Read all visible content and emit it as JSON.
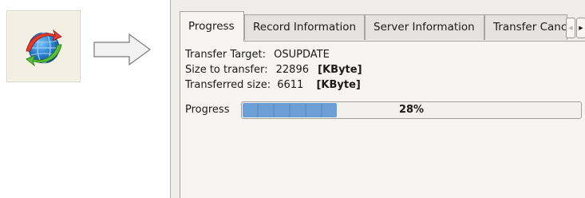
{
  "colors": {
    "progress_fill": "#6c9fd6",
    "panel_background": "#f6f5f2"
  },
  "launcher": {
    "icon": "globe-transfer-icon"
  },
  "arrow_icon": "right-arrow-icon",
  "tabs": [
    {
      "label": "Progress",
      "active": true
    },
    {
      "label": "Record Information",
      "active": false
    },
    {
      "label": "Server Information",
      "active": false
    },
    {
      "label": "Transfer Cancel",
      "active": false
    }
  ],
  "tab_scroll": {
    "prev_icon": "chevron-left-icon",
    "next_icon": "chevron-right-icon"
  },
  "details": {
    "target_label": "Transfer Target:",
    "target_value": "OSUPDATE",
    "size_label": "Size to transfer:",
    "size_value": "22896",
    "size_unit": "[KByte]",
    "transferred_label": "Transferred size:",
    "transferred_value": "6611",
    "transferred_unit": "[KByte]"
  },
  "progress": {
    "label": "Progress",
    "text": "28%",
    "fraction": 0.28
  }
}
